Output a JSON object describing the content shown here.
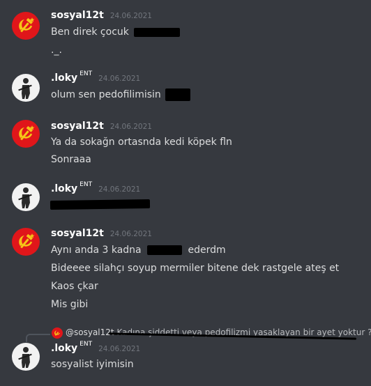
{
  "messages": [
    {
      "user": "sosyal12t",
      "time": "24.06.2021",
      "lines": [
        "Ben direk çocuk",
        "._."
      ]
    },
    {
      "user": ".loky",
      "tag": "ENT",
      "time": "24.06.2021",
      "lines": [
        "olum sen pedofilimisin"
      ]
    },
    {
      "user": "sosyal12t",
      "time": "24.06.2021",
      "lines": [
        "Ya da sokağn ortasnda kedi köpek fln",
        "Sonraaa"
      ]
    },
    {
      "user": ".loky",
      "tag": "ENT",
      "time": "24.06.2021",
      "lines": []
    },
    {
      "user": "sosyal12t",
      "time": "24.06.2021",
      "lines": [
        "Aynı anda 3 kadna",
        "ederdm",
        "Bideeee silahçı soyup mermiler bitene dek rastgele ateş et",
        "Kaos çkar",
        "Mis gibi"
      ]
    },
    {
      "reply": {
        "user": "@sosyal12t",
        "text": "Kadına şiddetti veya pedofilizmi yasaklayan bir ayet yoktur ?"
      },
      "user": ".loky",
      "tag": "ENT",
      "time": "24.06.2021",
      "lines": [
        "sosyalist iyimisin"
      ]
    }
  ],
  "icons": {
    "red_avatar": "hammer-sickle-icon",
    "white_avatar": "soldier-icon"
  },
  "colors": {
    "background": "#36393f",
    "username": "#ffffff",
    "text": "#dcddde",
    "timestamp": "#72767d",
    "red_avatar": "#e0161a"
  }
}
